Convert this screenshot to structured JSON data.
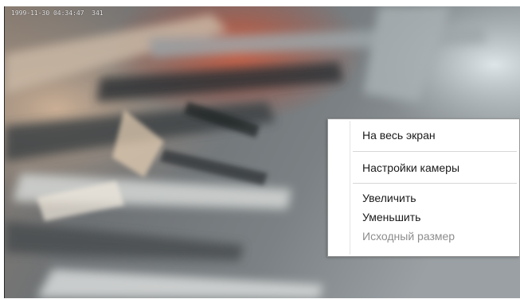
{
  "camera_view": {
    "timestamp": "1999-11-30 04:34:47  341"
  },
  "context_menu": {
    "items": [
      {
        "label": "На весь экран",
        "enabled": true
      },
      {
        "label": "Настройки камеры",
        "enabled": true
      },
      {
        "label": "Увеличить",
        "enabled": true
      },
      {
        "label": "Уменьшить",
        "enabled": true
      },
      {
        "label": "Исходный размер",
        "enabled": false
      }
    ]
  },
  "colors": {
    "menu_background": "#ffffff",
    "menu_border": "#979797",
    "menu_text": "#1a1a1a",
    "menu_text_disabled": "#8d8d8d"
  }
}
